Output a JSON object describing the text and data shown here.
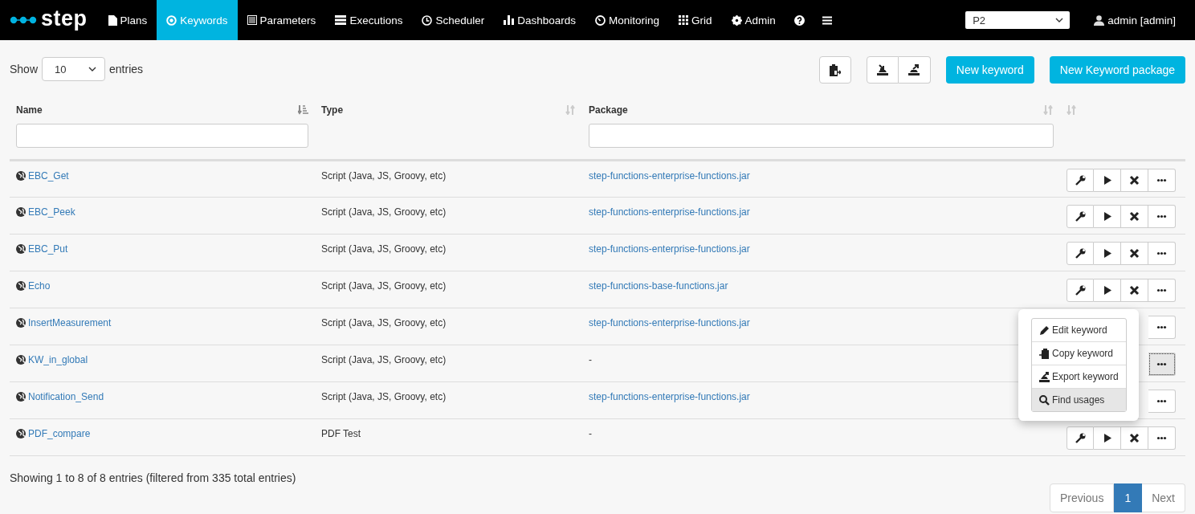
{
  "navbar": {
    "logo": "step",
    "items": [
      {
        "label": "Plans",
        "selected": false
      },
      {
        "label": "Keywords",
        "selected": true
      },
      {
        "label": "Parameters",
        "selected": false
      },
      {
        "label": "Executions",
        "selected": false
      },
      {
        "label": "Scheduler",
        "selected": false
      },
      {
        "label": "Dashboards",
        "selected": false
      },
      {
        "label": "Monitoring",
        "selected": false
      },
      {
        "label": "Grid",
        "selected": false
      },
      {
        "label": "Admin",
        "selected": false
      }
    ],
    "project": "P2",
    "user": "admin [admin]"
  },
  "toolbar": {
    "show_label": "Show",
    "page_size": "10",
    "entries_label": "entries",
    "buttons": [
      "New keyword",
      "New Keyword package"
    ]
  },
  "table": {
    "columns": [
      {
        "label": "Name",
        "sorted": true,
        "filter": true
      },
      {
        "label": "Type",
        "sorted": false,
        "filter": false
      },
      {
        "label": "Package",
        "sorted": false,
        "filter": true
      },
      {
        "sorted": false,
        "filter": false
      }
    ],
    "rows": [
      {
        "name": "EBC_Get",
        "type": "Script (Java, JS, Groovy, etc)",
        "package": "step-functions-enterprise-functions.jar",
        "package_linked": true,
        "menu_open": false
      },
      {
        "name": "EBC_Peek",
        "type": "Script (Java, JS, Groovy, etc)",
        "package": "step-functions-enterprise-functions.jar",
        "package_linked": true,
        "menu_open": false
      },
      {
        "name": "EBC_Put",
        "type": "Script (Java, JS, Groovy, etc)",
        "package": "step-functions-enterprise-functions.jar",
        "package_linked": true,
        "menu_open": false
      },
      {
        "name": "Echo",
        "type": "Script (Java, JS, Groovy, etc)",
        "package": "step-functions-base-functions.jar",
        "package_linked": true,
        "menu_open": false
      },
      {
        "name": "InsertMeasurement",
        "type": "Script (Java, JS, Groovy, etc)",
        "package": "step-functions-enterprise-functions.jar",
        "package_linked": true,
        "menu_open": false
      },
      {
        "name": "KW_in_global",
        "type": "Script (Java, JS, Groovy, etc)",
        "package": "-",
        "package_linked": false,
        "menu_open": true
      },
      {
        "name": "Notification_Send",
        "type": "Script (Java, JS, Groovy, etc)",
        "package": "step-functions-enterprise-functions.jar",
        "package_linked": true,
        "menu_open": false
      },
      {
        "name": "PDF_compare",
        "type": "PDF Test",
        "package": "-",
        "package_linked": false,
        "menu_open": false
      }
    ]
  },
  "row_menu": {
    "items": [
      {
        "label": "Edit keyword",
        "highlighted": false
      },
      {
        "label": "Copy keyword",
        "highlighted": false
      },
      {
        "label": "Export keyword",
        "highlighted": false
      },
      {
        "label": "Find usages",
        "highlighted": true
      }
    ]
  },
  "footer": {
    "info": "Showing 1 to 8 of 8 entries (filtered from 335 total entries)",
    "pages": [
      {
        "label": "Previous",
        "selected": false,
        "disabled": true
      },
      {
        "label": "1",
        "selected": true,
        "disabled": false
      },
      {
        "label": "Next",
        "selected": false,
        "disabled": true
      }
    ]
  }
}
